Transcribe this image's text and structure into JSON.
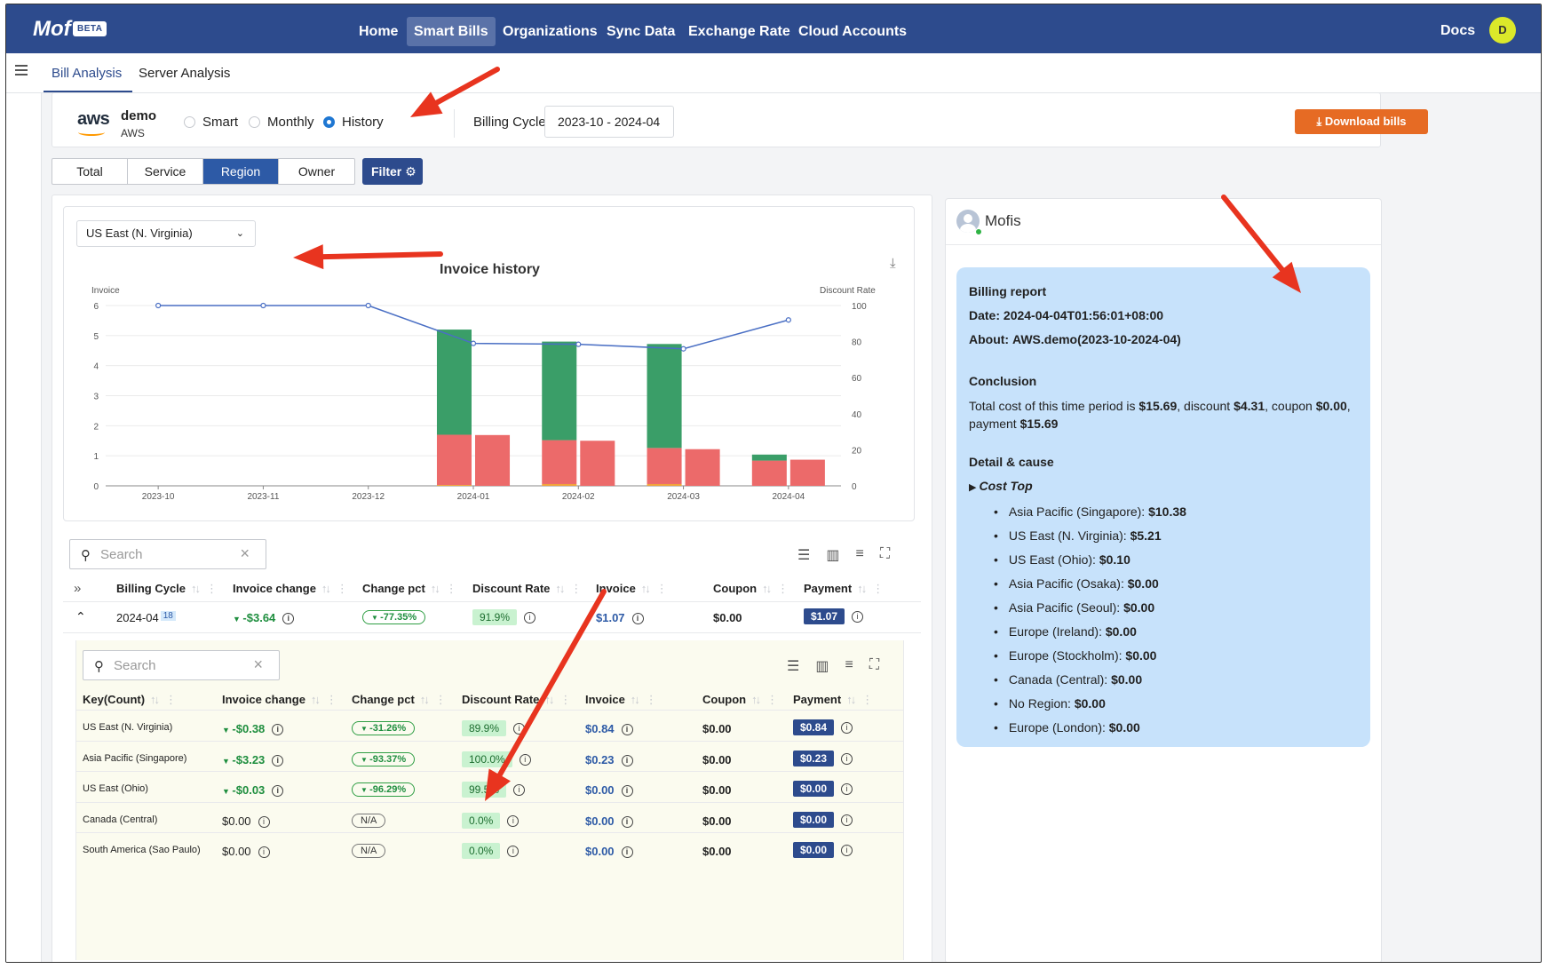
{
  "app": {
    "logo": "Mof",
    "badge": "BETA"
  },
  "nav": {
    "items": [
      "Home",
      "Smart Bills",
      "Organizations",
      "Sync Data",
      "Exchange Rate",
      "Cloud Accounts"
    ],
    "active": "Smart Bills",
    "docs": "Docs",
    "avatar_letter": "D"
  },
  "subnav": {
    "tabs": [
      "Bill Analysis",
      "Server Analysis"
    ],
    "active": "Bill Analysis"
  },
  "account": {
    "provider_logo": "aws",
    "name": "demo",
    "sub": "AWS"
  },
  "mode": {
    "options": [
      "Smart",
      "Monthly",
      "History"
    ],
    "selected": "History"
  },
  "billing_cycle": {
    "label": "Billing Cycle",
    "value": "2023-10 - 2024-04"
  },
  "download_label": "Download bills",
  "dimensions": {
    "tabs": [
      "Total",
      "Service",
      "Region",
      "Owner"
    ],
    "active": "Region"
  },
  "filter_label": "Filter",
  "region_select": "US East (N. Virginia)",
  "chart_data": {
    "type": "bar",
    "title": "Invoice history",
    "y_left_label": "Invoice",
    "y_right_label": "Discount Rate",
    "categories": [
      "2023-10",
      "2023-11",
      "2023-12",
      "2024-01",
      "2024-02",
      "2024-03",
      "2024-04"
    ],
    "y_left_ticks": [
      0,
      1,
      2,
      3,
      4,
      5,
      6
    ],
    "y_right_ticks": [
      0,
      20,
      40,
      60,
      80,
      100
    ],
    "ylim_left": [
      0,
      6
    ],
    "ylim_right": [
      0,
      100
    ],
    "stacked_bars": [
      {
        "bottom": 0.0,
        "mid": 0.0,
        "top": 0.0
      },
      {
        "bottom": 0.0,
        "mid": 0.0,
        "top": 0.0
      },
      {
        "bottom": 0.0,
        "mid": 0.0,
        "top": 0.0
      },
      {
        "bottom": 0.03,
        "mid": 1.67,
        "top": 3.5
      },
      {
        "bottom": 0.06,
        "mid": 1.46,
        "top": 3.28
      },
      {
        "bottom": 0.06,
        "mid": 1.2,
        "top": 3.46
      },
      {
        "bottom": 0.0,
        "mid": 0.84,
        "top": 0.2
      }
    ],
    "plain_bars": [
      0.0,
      0.0,
      0.0,
      1.69,
      1.5,
      1.22,
      0.87
    ],
    "line": [
      100,
      100,
      100,
      79,
      78.5,
      76,
      92
    ],
    "colors": {
      "green": "#3a9e68",
      "red": "#ec6a6a",
      "orange": "#f2a23a",
      "line": "#4a6fc4"
    },
    "grid": true
  },
  "main_table": {
    "search_placeholder": "Search",
    "headers": [
      "Billing Cycle",
      "Invoice change",
      "Change pct",
      "Discount Rate",
      "Invoice",
      "Coupon",
      "Payment"
    ],
    "row": {
      "cycle": "2024-04",
      "count": "18",
      "invoice_change": "-$3.64",
      "change_pct": "-77.35%",
      "discount_rate": "91.9%",
      "invoice": "$1.07",
      "coupon": "$0.00",
      "payment": "$1.07"
    }
  },
  "sub_table": {
    "search_placeholder": "Search",
    "headers": [
      "Key(Count)",
      "Invoice change",
      "Change pct",
      "Discount Rate",
      "Invoice",
      "Coupon",
      "Payment"
    ],
    "rows": [
      {
        "key": "US East (N. Virginia)",
        "invoice_change": "-$0.38",
        "change_pct": "-31.26%",
        "discount_rate": "89.9%",
        "invoice": "$0.84",
        "coupon": "$0.00",
        "payment": "$0.84",
        "down": true
      },
      {
        "key": "Asia Pacific (Singapore)",
        "invoice_change": "-$3.23",
        "change_pct": "-93.37%",
        "discount_rate": "100.0%",
        "invoice": "$0.23",
        "coupon": "$0.00",
        "payment": "$0.23",
        "down": true
      },
      {
        "key": "US East (Ohio)",
        "invoice_change": "-$0.03",
        "change_pct": "-96.29%",
        "discount_rate": "99.5%",
        "invoice": "$0.00",
        "coupon": "$0.00",
        "payment": "$0.00",
        "down": true
      },
      {
        "key": "Canada (Central)",
        "invoice_change": "$0.00",
        "change_pct": "N/A",
        "discount_rate": "0.0%",
        "invoice": "$0.00",
        "coupon": "$0.00",
        "payment": "$0.00",
        "down": false
      },
      {
        "key": "South America (Sao Paulo)",
        "invoice_change": "$0.00",
        "change_pct": "N/A",
        "discount_rate": "0.0%",
        "invoice": "$0.00",
        "coupon": "$0.00",
        "payment": "$0.00",
        "down": false
      }
    ]
  },
  "mofis": {
    "title": "Mofis",
    "report_title": "Billing report",
    "date_label": "Date:",
    "date": "2024-04-04T01:56:01+08:00",
    "about_label": "About:",
    "about": "AWS.demo(2023-10-2024-04)",
    "conclusion_title": "Conclusion",
    "conclusion_parts": [
      "Total cost of this time period is ",
      "$15.69",
      ", discount ",
      "$4.31",
      ", coupon ",
      "$0.00",
      ",",
      "payment ",
      "$15.69"
    ],
    "detail_title": "Detail & cause",
    "cost_top_label": "Cost Top",
    "cost_top": [
      {
        "region": "Asia Pacific (Singapore):",
        "amount": "$10.38"
      },
      {
        "region": "US East (N. Virginia):",
        "amount": "$5.21"
      },
      {
        "region": "US East (Ohio):",
        "amount": "$0.10"
      },
      {
        "region": "Asia Pacific (Osaka):",
        "amount": "$0.00"
      },
      {
        "region": "Asia Pacific (Seoul):",
        "amount": "$0.00"
      },
      {
        "region": "Europe (Ireland):",
        "amount": "$0.00"
      },
      {
        "region": "Europe (Stockholm):",
        "amount": "$0.00"
      },
      {
        "region": "Canada (Central):",
        "amount": "$0.00"
      },
      {
        "region": "No Region:",
        "amount": "$0.00"
      },
      {
        "region": "Europe (London):",
        "amount": "$0.00"
      }
    ]
  },
  "annotation_color": "#e8341f"
}
